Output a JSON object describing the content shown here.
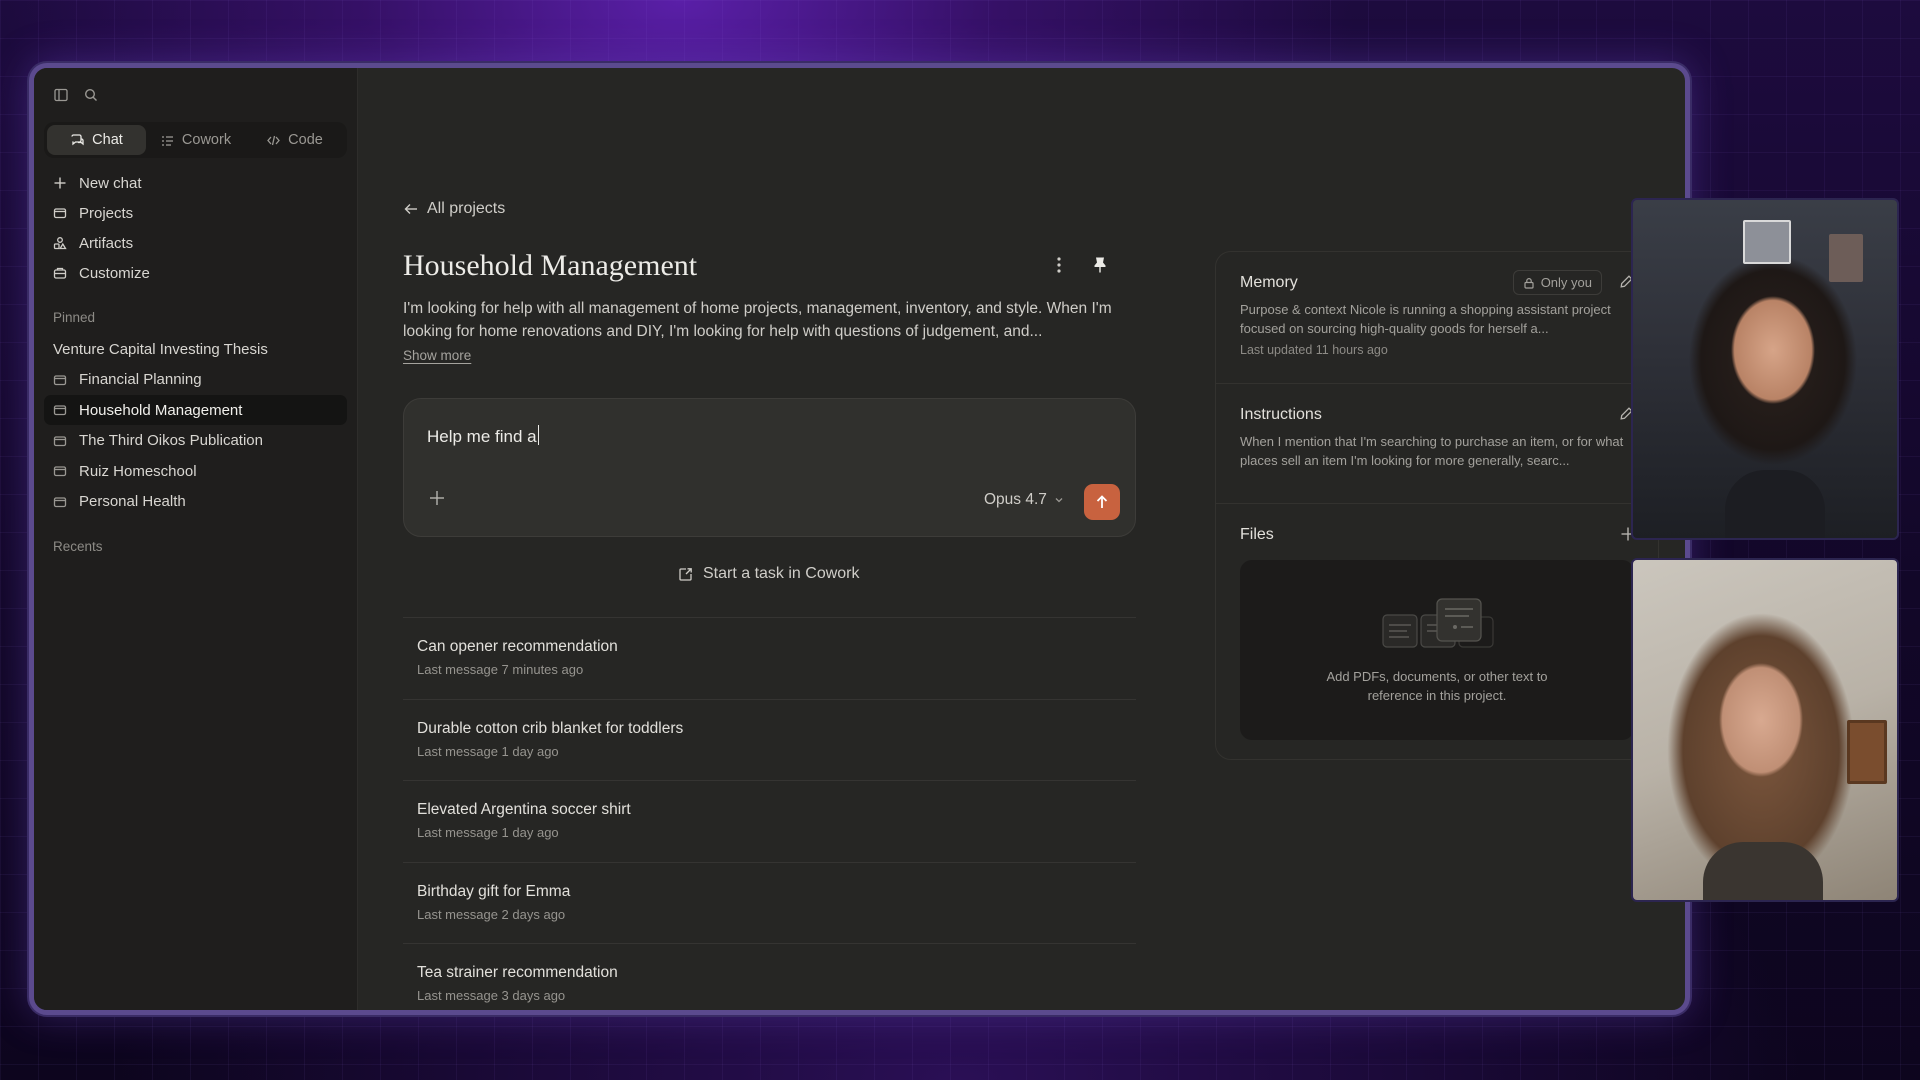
{
  "sidebar": {
    "modes": [
      {
        "label": "Chat",
        "active": true
      },
      {
        "label": "Cowork",
        "active": false
      },
      {
        "label": "Code",
        "active": false
      }
    ],
    "nav": [
      {
        "label": "New chat",
        "icon": "plus-icon"
      },
      {
        "label": "Projects",
        "icon": "folder-icon"
      },
      {
        "label": "Artifacts",
        "icon": "artifacts-icon"
      },
      {
        "label": "Customize",
        "icon": "customize-icon"
      }
    ],
    "pinned_label": "Pinned",
    "pinned": [
      {
        "label": "Venture Capital Investing Thesis",
        "icon": false
      },
      {
        "label": "Financial Planning",
        "icon": true
      },
      {
        "label": "Household Management",
        "icon": true,
        "active": true
      },
      {
        "label": "The Third Oikos Publication",
        "icon": true
      },
      {
        "label": "Ruiz Homeschool",
        "icon": true
      },
      {
        "label": "Personal Health",
        "icon": true
      }
    ],
    "recents_label": "Recents"
  },
  "main": {
    "back_label": "All projects",
    "title": "Household Management",
    "description": "I'm looking for help with all management of home projects, management, inventory, and style. When I'm looking for home renovations and DIY, I'm looking for help with questions of judgement, and...",
    "show_more": "Show more",
    "composer": {
      "value": "Help me find a",
      "model": "Opus 4.7"
    },
    "cowork_label": "Start a task in Cowork",
    "chats": [
      {
        "title": "Can opener recommendation",
        "meta": "Last message 7 minutes ago"
      },
      {
        "title": "Durable cotton crib blanket for toddlers",
        "meta": "Last message 1 day ago"
      },
      {
        "title": "Elevated Argentina soccer shirt",
        "meta": "Last message 1 day ago"
      },
      {
        "title": "Birthday gift for Emma",
        "meta": "Last message 2 days ago"
      },
      {
        "title": "Tea strainer recommendation",
        "meta": "Last message 3 days ago"
      }
    ]
  },
  "panel": {
    "memory": {
      "title": "Memory",
      "badge": "Only you",
      "text": "Purpose & context Nicole is running a shopping assistant project focused on sourcing high-quality goods for herself a...",
      "meta": "Last updated 11 hours ago"
    },
    "instructions": {
      "title": "Instructions",
      "text": "When I mention that I'm searching to purchase an item, or for what places sell an item I'm looking for more generally, searc..."
    },
    "files": {
      "title": "Files",
      "empty_text": "Add PDFs, documents, or other text to reference in this project."
    }
  },
  "colors": {
    "accent": "#c8623f",
    "app_bg": "#262624",
    "sidebar_bg": "#1f1e1d",
    "frame_border": "#5b4a8e"
  }
}
